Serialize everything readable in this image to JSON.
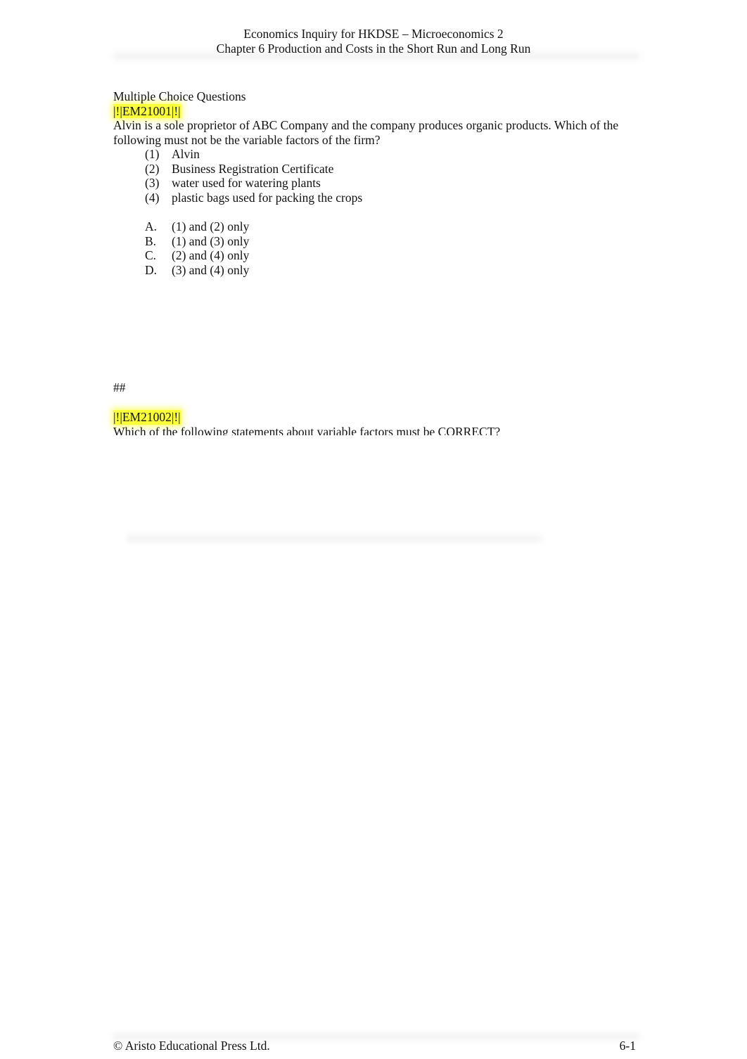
{
  "header": {
    "book_title": "Economics Inquiry for HKDSE – Microeconomics 2",
    "chapter_title": "Chapter 6  Production and Costs in the Short Run and Long Run"
  },
  "section": {
    "title": "Multiple Choice Questions"
  },
  "questions": [
    {
      "id": "|!|EM21001|!|",
      "stem": "Alvin is a sole proprietor of ABC Company and the company produces organic products. Which of the following must not be the variable factors of the firm?",
      "items": [
        {
          "label": "(1)",
          "text": "Alvin"
        },
        {
          "label": "(2)",
          "text": "Business Registration Certificate"
        },
        {
          "label": "(3)",
          "text": "water used for watering plants"
        },
        {
          "label": "(4)",
          "text": "plastic bags used for packing the crops"
        }
      ],
      "options": [
        {
          "label": "A.",
          "text": "(1) and (2) only"
        },
        {
          "label": "B.",
          "text": "(1) and (3) only"
        },
        {
          "label": "C.",
          "text": "(2) and (4) only"
        },
        {
          "label": "D.",
          "text": "(3) and (4) only"
        }
      ]
    },
    {
      "id": "|!|EM21002|!|",
      "stem": "Which of the following statements about variable factors must be CORRECT?"
    }
  ],
  "separator": "##",
  "footer": {
    "copyright": "© Aristo Educational Press Ltd.",
    "page_number": "6-1"
  },
  "colors": {
    "highlight": "#fbff3a",
    "text": "#111111"
  }
}
